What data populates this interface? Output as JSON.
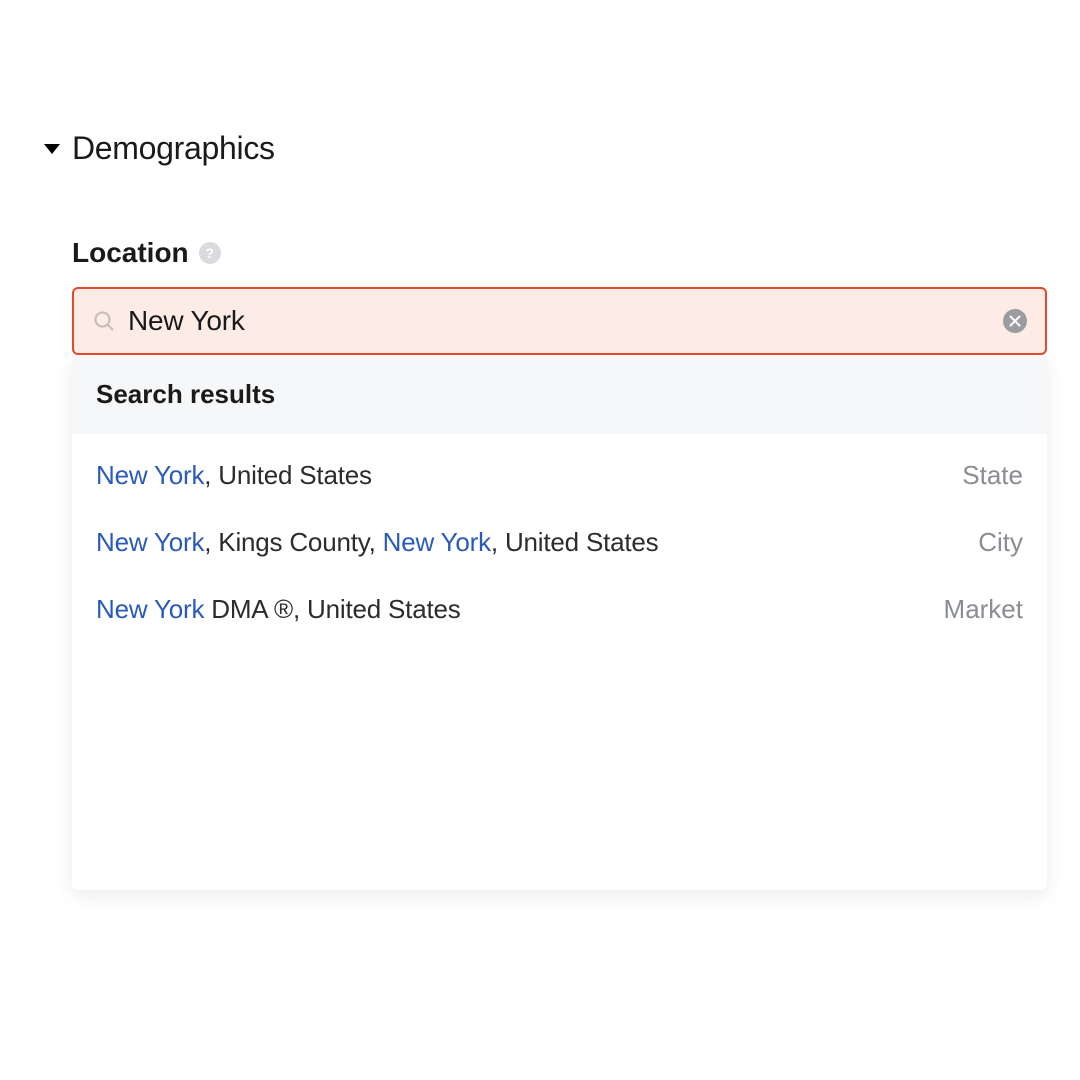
{
  "section": {
    "title": "Demographics"
  },
  "field": {
    "label": "Location"
  },
  "search": {
    "value": "New York",
    "placeholder": ""
  },
  "dropdown": {
    "header": "Search results",
    "results": [
      {
        "parts": [
          {
            "text": "New York",
            "highlight": true
          },
          {
            "text": ", United States",
            "highlight": false
          }
        ],
        "type": "State"
      },
      {
        "parts": [
          {
            "text": "New York",
            "highlight": true
          },
          {
            "text": ", Kings County, ",
            "highlight": false
          },
          {
            "text": "New York",
            "highlight": true
          },
          {
            "text": ", United States",
            "highlight": false
          }
        ],
        "type": "City"
      },
      {
        "parts": [
          {
            "text": "New York",
            "highlight": true
          },
          {
            "text": " DMA ®, United States",
            "highlight": false
          }
        ],
        "type": "Market"
      }
    ]
  }
}
